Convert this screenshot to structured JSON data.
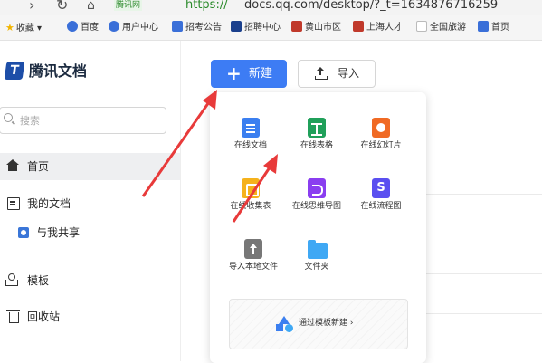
{
  "browser": {
    "url_secure_badge": "腾讯网",
    "url_protocol": "https://",
    "url_rest": "docs.qq.com/desktop/?_t=1634876716259",
    "bookmarks": [
      {
        "label": "收藏",
        "icon": "star-icon",
        "color": "#f1b400"
      },
      {
        "label": "百度",
        "icon": "baidu-icon",
        "color": "#3a6fd8"
      },
      {
        "label": "用户中心",
        "icon": "user-center-icon",
        "color": "#3a6fd8"
      },
      {
        "label": "招考公告",
        "icon": "notice-icon",
        "color": "#3a6fd8"
      },
      {
        "label": "招聘中心",
        "icon": "job-icon",
        "color": "#1a3f8c"
      },
      {
        "label": "黄山市区",
        "icon": "city-icon",
        "color": "#c0392b"
      },
      {
        "label": "上海人才",
        "icon": "talent-icon",
        "color": "#c0392b"
      },
      {
        "label": "全国旅游",
        "icon": "page-icon",
        "color": "#bbbbbb"
      },
      {
        "label": "首页",
        "icon": "home-icon",
        "color": "#3a6fd8"
      }
    ]
  },
  "sidebar": {
    "logo_text": "腾讯文档",
    "search_placeholder": "搜索",
    "items": [
      {
        "label": "首页",
        "icon": "home-icon"
      },
      {
        "label": "我的文档",
        "icon": "document-icon"
      },
      {
        "label": "与我共享",
        "icon": "shared-icon"
      },
      {
        "label": "模板",
        "icon": "template-icon"
      },
      {
        "label": "回收站",
        "icon": "trash-icon"
      }
    ]
  },
  "toolbar": {
    "new_label": "新建",
    "import_label": "导入"
  },
  "new_menu": {
    "items": [
      {
        "label": "在线文档",
        "icon": "online-doc-icon"
      },
      {
        "label": "在线表格",
        "icon": "online-sheet-icon"
      },
      {
        "label": "在线幻灯片",
        "icon": "online-slides-icon"
      },
      {
        "label": "在线收集表",
        "icon": "online-form-icon"
      },
      {
        "label": "在线思维导图",
        "icon": "mind-map-icon"
      },
      {
        "label": "在线流程图",
        "icon": "flowchart-icon"
      },
      {
        "label": "导入本地文件",
        "icon": "upload-icon"
      },
      {
        "label": "文件夹",
        "icon": "folder-icon"
      }
    ],
    "template_new_label": "通过模板新建 ›"
  },
  "colors": {
    "accent": "#3d7cf4",
    "annotation": "#e83a3a"
  }
}
